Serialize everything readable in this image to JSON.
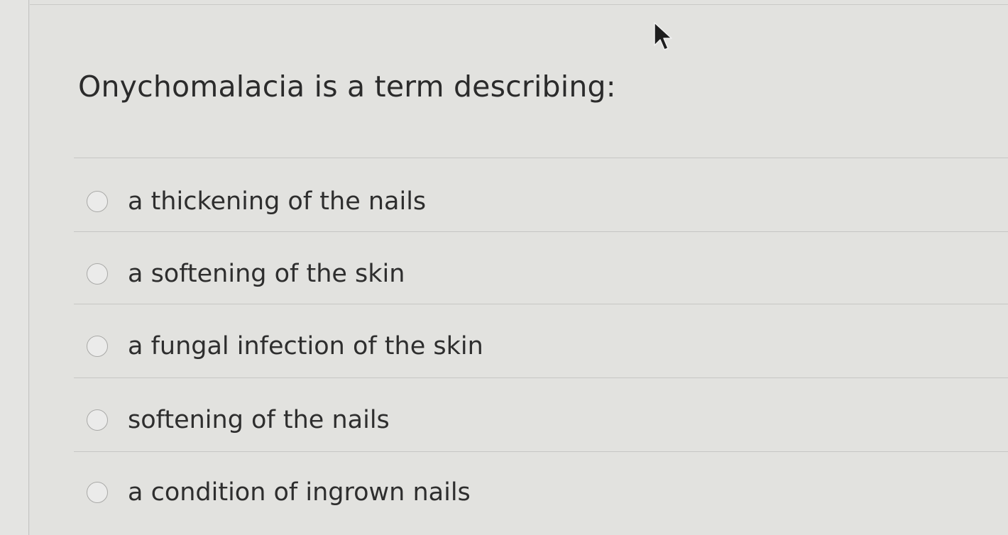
{
  "question": {
    "text": "Onychomalacia is a term describing:"
  },
  "options": [
    {
      "label": "a thickening of the nails"
    },
    {
      "label": "a softening of the skin"
    },
    {
      "label": "a fungal infection of the skin"
    },
    {
      "label": "softening of the nails"
    },
    {
      "label": "a condition of ingrown nails"
    }
  ],
  "icons": {
    "cursor": "mouse-pointer-icon",
    "radio": "radio-button-icon"
  },
  "colors": {
    "background": "#e2e2df",
    "text": "#2b2b2b",
    "divider": "#c6c6c4",
    "radio_border": "#a9a9a7"
  }
}
